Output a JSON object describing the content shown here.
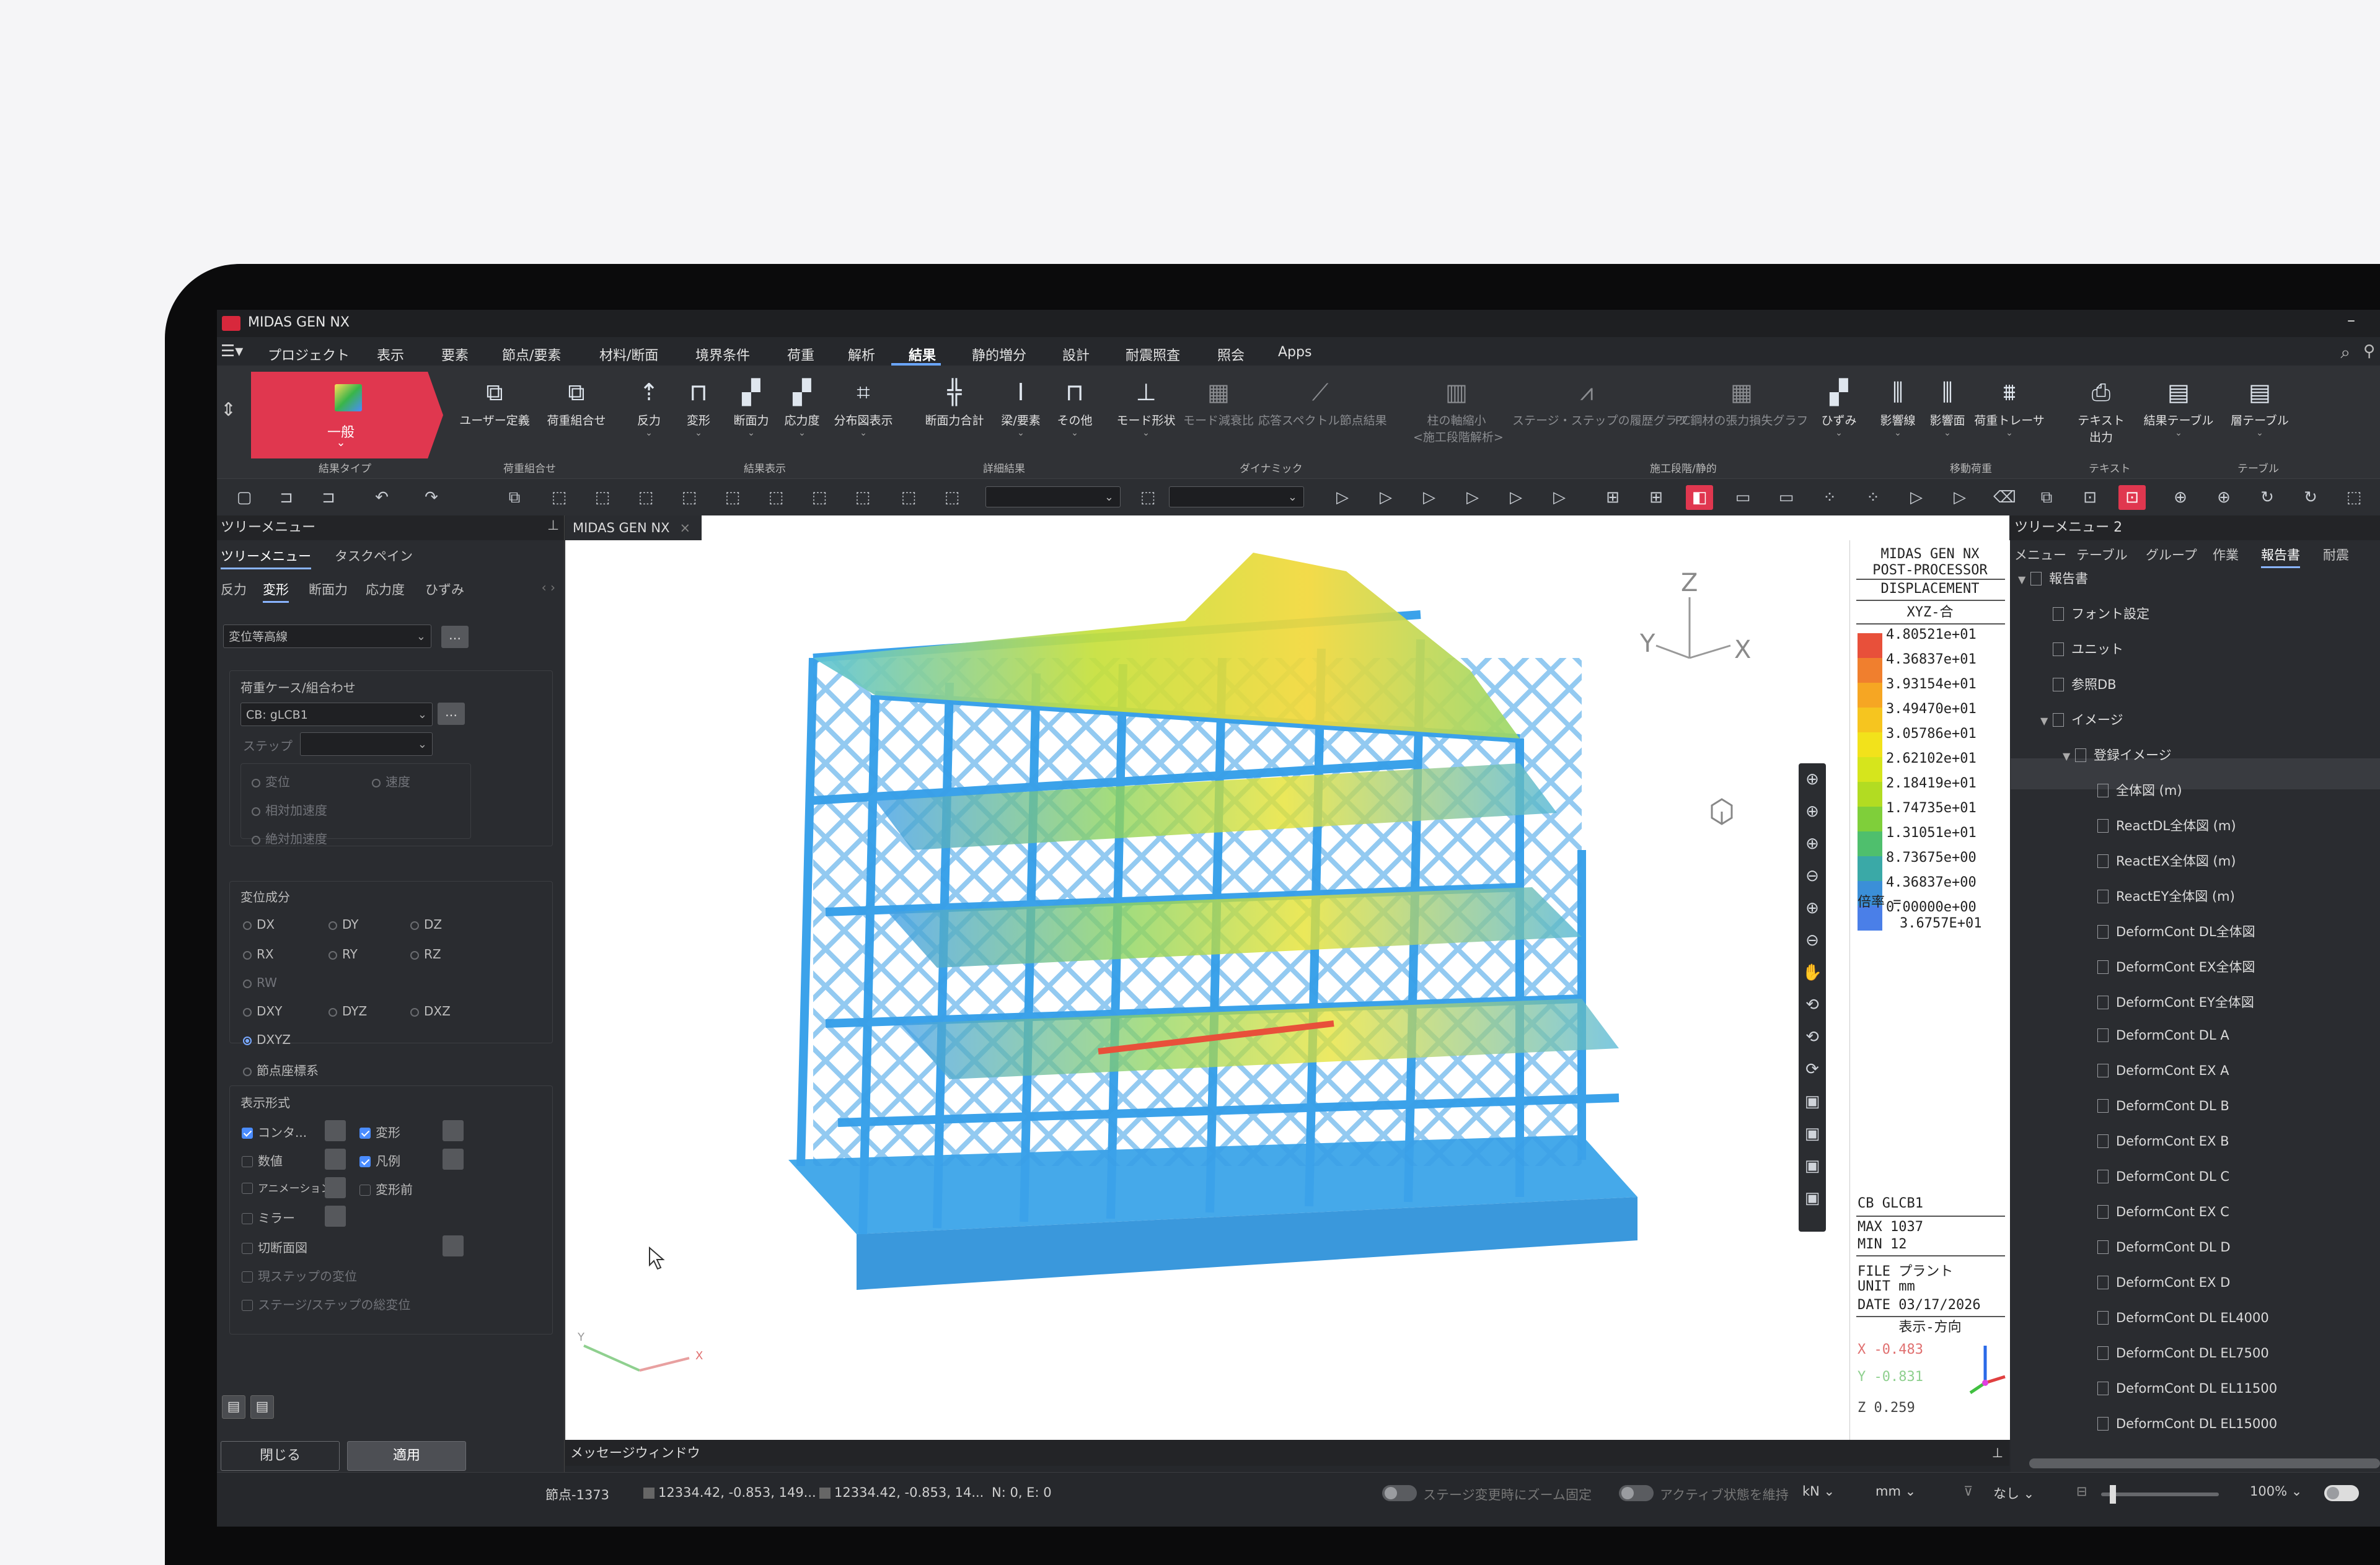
{
  "window": {
    "title": "MIDAS GEN NX"
  },
  "menu": {
    "items": [
      "プロジェクト",
      "表示",
      "要素",
      "節点/要素",
      "材料/断面",
      "境界条件",
      "荷重",
      "解析",
      "結果",
      "静的増分",
      "設計",
      "耐震照査",
      "照会",
      "Apps"
    ],
    "active": "結果"
  },
  "ribbon": {
    "hero_label": "一般",
    "buttons": [
      {
        "label": "ユーザー定義"
      },
      {
        "label": "荷重組合せ"
      },
      {
        "label": "反力"
      },
      {
        "label": "変形"
      },
      {
        "label": "断面力"
      },
      {
        "label": "応力度"
      },
      {
        "label": "分布図表示"
      },
      {
        "label": "断面力合計"
      },
      {
        "label": "梁/要素"
      },
      {
        "label": "その他"
      },
      {
        "label": "モード形状"
      },
      {
        "label": "モード減衰比"
      },
      {
        "label": "応答スペクトル節点結果"
      },
      {
        "label": "柱の軸縮小"
      },
      {
        "label": "<施工段階解析>"
      },
      {
        "label": "ステージ・ステップの履歴グラフ"
      },
      {
        "label": "PC鋼材の張力損失グラフ"
      },
      {
        "label": "ひずみ"
      },
      {
        "label": "影響線"
      },
      {
        "label": "影響面"
      },
      {
        "label": "荷重トレーサ"
      },
      {
        "label": "テキスト"
      },
      {
        "label": "出力"
      },
      {
        "label": "結果テーブル"
      },
      {
        "label": "層テーブル"
      }
    ],
    "groups": [
      "結果タイプ",
      "荷重組合せ",
      "結果表示",
      "詳細結果",
      "ダイナミック",
      "施工段階/静的",
      "移動荷重",
      "テキスト",
      "テーブル"
    ]
  },
  "left_panel": {
    "title": "ツリーメニュー",
    "tabs": [
      "ツリーメニュー",
      "タスクペイン"
    ],
    "active_tab": "ツリーメニュー",
    "subtabs": [
      "反力",
      "変形",
      "断面力",
      "応力度",
      "ひずみ"
    ],
    "active_subtab": "変形",
    "display_mode": "変位等高線",
    "load_case_label": "荷重ケース/組合わせ",
    "load_case_value": "CB: gLCB1",
    "step_label": "ステップ",
    "type_options": [
      "変位",
      "速度",
      "相対加速度",
      "絶対加速度"
    ],
    "component_label": "変位成分",
    "components": [
      "DX",
      "DY",
      "DZ",
      "RX",
      "RY",
      "RZ",
      "RW",
      "DXY",
      "DYZ",
      "DXZ",
      "DXYZ"
    ],
    "selected_component": "DXYZ",
    "node_coord": "節点座標系",
    "display_label": "表示形式",
    "display_options": [
      {
        "label": "コンタ...",
        "checked": true
      },
      {
        "label": "変形",
        "checked": true
      },
      {
        "label": "数値",
        "checked": false
      },
      {
        "label": "凡例",
        "checked": true
      },
      {
        "label": "アニメーション",
        "checked": false
      },
      {
        "label": "変形前",
        "checked": false
      },
      {
        "label": "ミラー",
        "checked": false
      },
      {
        "label": "切断面図",
        "checked": false
      },
      {
        "label": "現ステップの変位",
        "checked": false
      },
      {
        "label": "ステージ/ステップの総変位",
        "checked": false
      }
    ],
    "close_button": "閉じる",
    "apply_button": "適用"
  },
  "viewport": {
    "tab_label": "MIDAS GEN NX",
    "axis": {
      "x": "X",
      "y": "Y",
      "z": "Z"
    },
    "legend": {
      "header": [
        "MIDAS GEN NX",
        "POST-PROCESSOR",
        "DISPLACEMENT"
      ],
      "subtitle": "XYZ-合",
      "values": [
        "4.80521e+01",
        "4.36837e+01",
        "3.93154e+01",
        "3.49470e+01",
        "3.05786e+01",
        "2.62102e+01",
        "2.18419e+01",
        "1.74735e+01",
        "1.31051e+01",
        "8.73675e+00",
        "4.36837e+00",
        "0.00000e+00"
      ],
      "colors": [
        "#e8503a",
        "#f07f2e",
        "#f6a623",
        "#f6c51f",
        "#f2e21b",
        "#d6e51c",
        "#b2dc22",
        "#7fcf3a",
        "#4fbf6d",
        "#3aa9a7",
        "#3b8fd8",
        "#4a7fe8"
      ],
      "scale_label": "倍率 =",
      "scale_value": "3.6757E+01",
      "info": {
        "case": "CB  GLCB1",
        "max": "MAX  1037",
        "min": "MIN  12",
        "file": "FILE  プラント",
        "unit": "UNIT  mm",
        "date": "DATE  03/17/2026",
        "view_dir": "表示-方向",
        "vx": "X -0.483",
        "vy": "Y -0.831",
        "vz": "Z  0.259"
      }
    }
  },
  "message_window": "メッセージウィンドウ",
  "right_panel": {
    "title": "ツリーメニュー 2",
    "tabs": [
      "メニュー",
      "テーブル",
      "グループ",
      "作業",
      "報告書",
      "耐震"
    ],
    "active_tab": "報告書",
    "tree": [
      {
        "label": "報告書",
        "level": 0,
        "twisty": "▼"
      },
      {
        "label": "フォント設定",
        "level": 1
      },
      {
        "label": "ユニット",
        "level": 1
      },
      {
        "label": "参照DB",
        "level": 1
      },
      {
        "label": "イメージ",
        "level": 1,
        "twisty": "▼"
      },
      {
        "label": "登録イメージ",
        "level": 2,
        "twisty": "▼"
      },
      {
        "label": "全体図 (m)",
        "level": 3
      },
      {
        "label": "ReactDL全体図 (m)",
        "level": 3
      },
      {
        "label": "ReactEX全体図 (m)",
        "level": 3
      },
      {
        "label": "ReactEY全体図 (m)",
        "level": 3
      },
      {
        "label": "DeformCont DL全体図",
        "level": 3
      },
      {
        "label": "DeformCont EX全体図",
        "level": 3
      },
      {
        "label": "DeformCont EY全体図",
        "level": 3
      },
      {
        "label": "DeformCont DL A",
        "level": 3
      },
      {
        "label": "DeformCont EX A",
        "level": 3
      },
      {
        "label": "DeformCont DL B",
        "level": 3
      },
      {
        "label": "DeformCont EX B",
        "level": 3
      },
      {
        "label": "DeformCont DL C",
        "level": 3
      },
      {
        "label": "DeformCont EX C",
        "level": 3
      },
      {
        "label": "DeformCont DL D",
        "level": 3
      },
      {
        "label": "DeformCont EX D",
        "level": 3
      },
      {
        "label": "DeformCont DL EL4000",
        "level": 3
      },
      {
        "label": "DeformCont DL EL7500",
        "level": 3
      },
      {
        "label": "DeformCont DL EL11500",
        "level": 3
      },
      {
        "label": "DeformCont DL EL15000",
        "level": 3
      }
    ]
  },
  "status": {
    "node": "節点-1373",
    "coord1": "12334.42, -0.853, 149...",
    "coord2": "12334.42, -0.853, 14...",
    "ne": "N: 0, E: 0",
    "zoom_fix": "ステージ変更時にズーム固定",
    "keep_active": "アクティブ状態を維持",
    "force_unit": "kN",
    "length_unit": "mm",
    "none_option": "なし",
    "zoom": "100%"
  }
}
